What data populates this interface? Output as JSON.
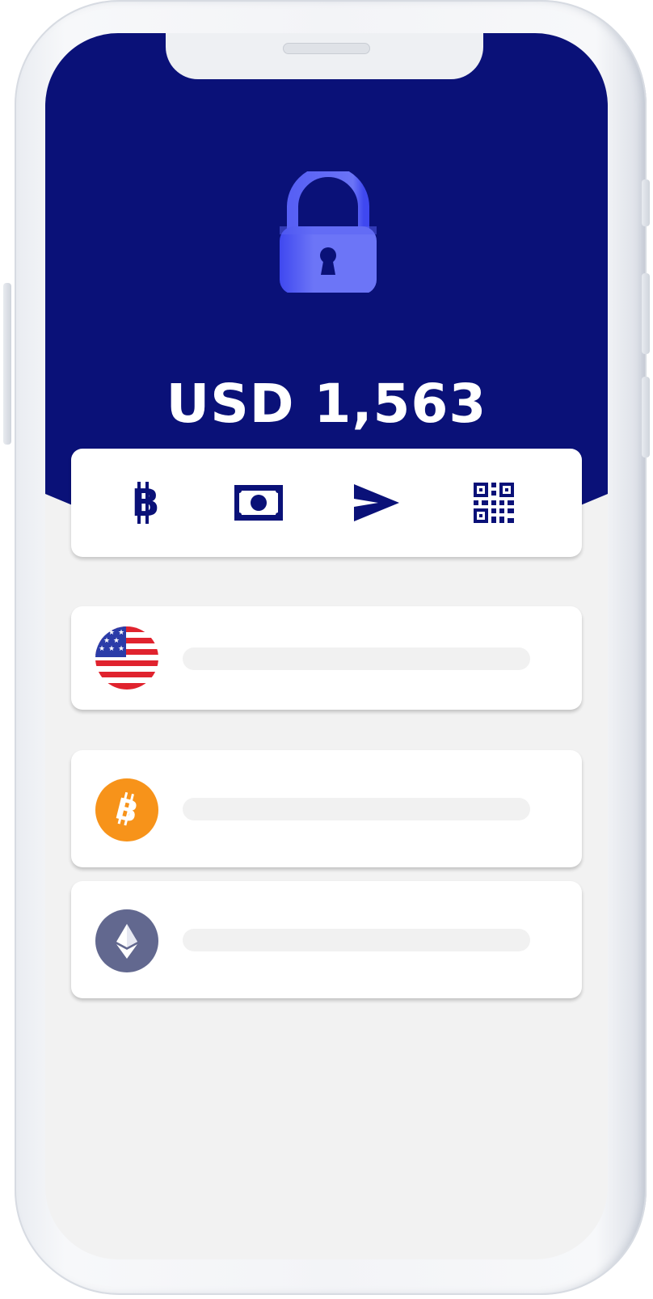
{
  "balance": {
    "text": "USD 1,563"
  },
  "actions": [
    {
      "icon": "bitcoin-icon"
    },
    {
      "icon": "cash-icon"
    },
    {
      "icon": "send-icon"
    },
    {
      "icon": "qr-code-icon"
    }
  ],
  "wallets": [
    {
      "icon": "us-flag-icon"
    },
    {
      "icon": "bitcoin-coin-icon"
    },
    {
      "icon": "ethereum-coin-icon"
    }
  ],
  "colors": {
    "header": "#0a1178",
    "lock": "#6b74f5",
    "bitcoin": "#f7931a",
    "ethereum": "#62688f",
    "placeholder": "#f1f1f1"
  }
}
